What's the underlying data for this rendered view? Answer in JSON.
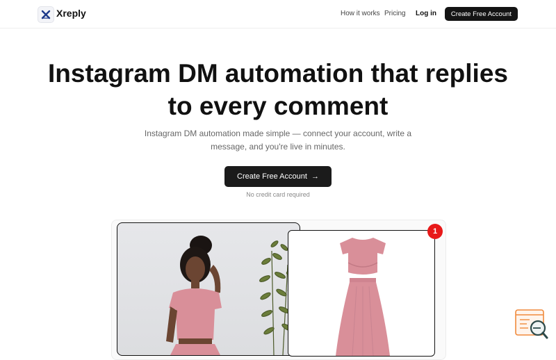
{
  "nav": {
    "brand": "Xreply",
    "links": [
      "How it works",
      "Pricing",
      "Log in"
    ],
    "cta": "Create Free Account"
  },
  "hero": {
    "title_line1": "Instagram DM automation that replies",
    "title_line2": "to every comment",
    "subtitle": "Instagram DM automation made simple — connect your account, write a message, and you're live in minutes.",
    "cta": "Create Free Account",
    "cta_arrow": "→",
    "note": "No credit card required"
  },
  "demo": {
    "badge_count": "1"
  },
  "colors": {
    "accent_dark": "#141414",
    "badge_red": "#e81919",
    "product_pink": "#d98f99"
  },
  "icons": [
    "x-logo-icon",
    "arrow-right-icon",
    "support-chat-icon"
  ]
}
